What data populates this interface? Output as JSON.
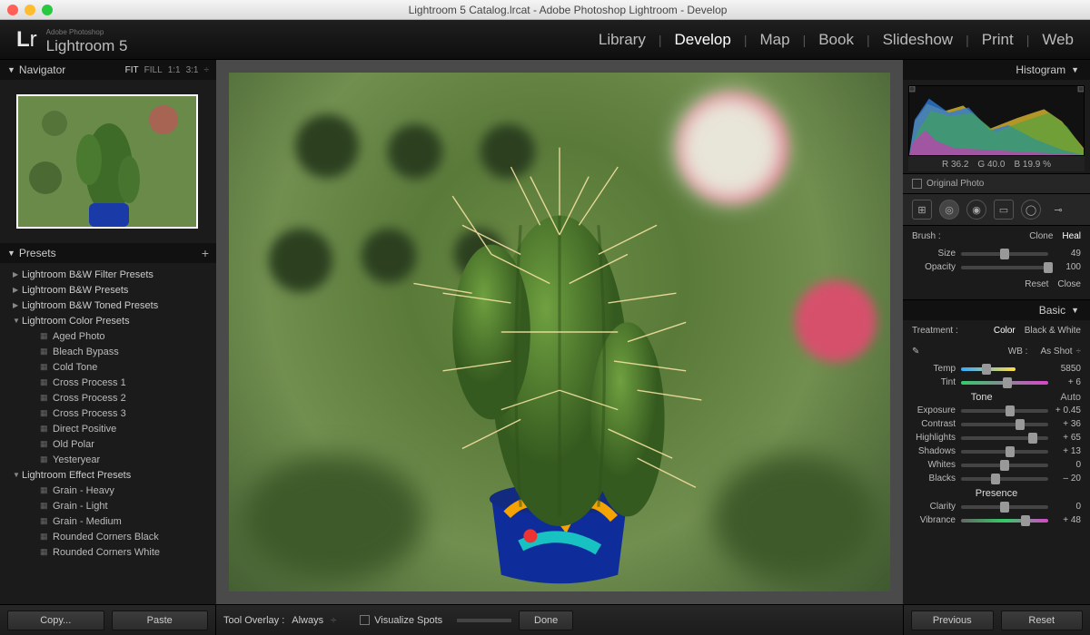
{
  "titlebar": {
    "title": "Lightroom 5 Catalog.lrcat - Adobe Photoshop Lightroom - Develop"
  },
  "header": {
    "brand_small": "Adobe Photoshop",
    "brand": "Lightroom 5",
    "modules": [
      "Library",
      "Develop",
      "Map",
      "Book",
      "Slideshow",
      "Print",
      "Web"
    ],
    "active_module": "Develop"
  },
  "navigator": {
    "title": "Navigator",
    "zoom_levels": [
      "FIT",
      "FILL",
      "1:1",
      "3:1"
    ]
  },
  "presets": {
    "title": "Presets",
    "groups": [
      {
        "name": "Lightroom B&W Filter Presets",
        "open": false
      },
      {
        "name": "Lightroom B&W Presets",
        "open": false
      },
      {
        "name": "Lightroom B&W Toned Presets",
        "open": false
      },
      {
        "name": "Lightroom Color Presets",
        "open": true,
        "items": [
          "Aged Photo",
          "Bleach Bypass",
          "Cold Tone",
          "Cross Process 1",
          "Cross Process 2",
          "Cross Process 3",
          "Direct Positive",
          "Old Polar",
          "Yesteryear"
        ]
      },
      {
        "name": "Lightroom Effect Presets",
        "open": true,
        "items": [
          "Grain - Heavy",
          "Grain - Light",
          "Grain - Medium",
          "Rounded Corners Black",
          "Rounded Corners White"
        ]
      }
    ]
  },
  "left_buttons": {
    "copy": "Copy...",
    "paste": "Paste"
  },
  "center_toolbar": {
    "tool_overlay_label": "Tool Overlay :",
    "tool_overlay_value": "Always",
    "visualize": "Visualize Spots",
    "done": "Done"
  },
  "right": {
    "histogram_title": "Histogram",
    "readout": {
      "r": "36.2",
      "g": "40.0",
      "b": "19.9",
      "pct": "%"
    },
    "original": "Original Photo",
    "brush_title": "Brush :",
    "brush_modes": [
      "Clone",
      "Heal"
    ],
    "brush_active": "Heal",
    "brush_sliders": [
      {
        "label": "Size",
        "value": "49",
        "pos": 50
      },
      {
        "label": "Opacity",
        "value": "100",
        "pos": 100
      }
    ],
    "brush_buttons": {
      "reset": "Reset",
      "close": "Close"
    },
    "basic_title": "Basic",
    "treatment_label": "Treatment :",
    "treatment_options": [
      "Color",
      "Black & White"
    ],
    "treatment_active": "Color",
    "wb_label": "WB :",
    "wb_value": "As Shot",
    "temp": {
      "label": "Temp",
      "value": "5850",
      "pos": 46
    },
    "tint": {
      "label": "Tint",
      "value": "+ 6",
      "pos": 53
    },
    "tone_title": "Tone",
    "auto": "Auto",
    "tone_sliders": [
      {
        "label": "Exposure",
        "value": "+ 0.45",
        "pos": 56
      },
      {
        "label": "Contrast",
        "value": "+ 36",
        "pos": 68
      },
      {
        "label": "Highlights",
        "value": "+ 65",
        "pos": 82
      },
      {
        "label": "Shadows",
        "value": "+ 13",
        "pos": 56
      },
      {
        "label": "Whites",
        "value": "0",
        "pos": 50
      },
      {
        "label": "Blacks",
        "value": "– 20",
        "pos": 40
      }
    ],
    "presence_title": "Presence",
    "presence_sliders": [
      {
        "label": "Clarity",
        "value": "0",
        "pos": 50
      },
      {
        "label": "Vibrance",
        "value": "+ 48",
        "pos": 74
      }
    ]
  },
  "bottom_right": {
    "previous": "Previous",
    "reset": "Reset"
  }
}
